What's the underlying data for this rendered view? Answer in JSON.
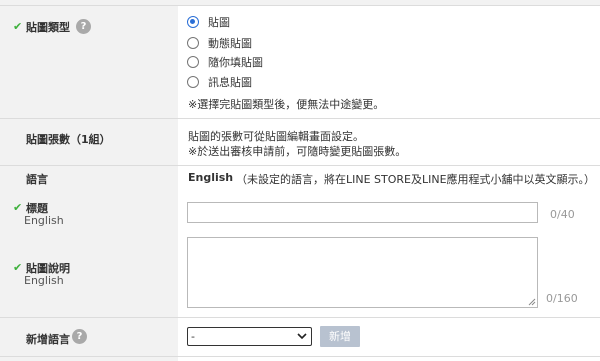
{
  "sticker_type": {
    "label": "貼圖類型",
    "help": "?",
    "check": "✔",
    "options": [
      "貼圖",
      "動態貼圖",
      "隨你填貼圖",
      "訊息貼圖"
    ],
    "selected_index": 0,
    "note": "※選擇完貼圖類型後，便無法中途變更。"
  },
  "sticker_count": {
    "label": "貼圖張數（1組）",
    "line1": "貼圖的張數可從貼圖編輯畫面設定。",
    "line2": "※於送出審核申請前，可隨時變更貼圖張數。"
  },
  "language": {
    "label": "語言",
    "value": "English",
    "note": "（未設定的語言，將在LINE STORE及LINE應用程式小舖中以英文顯示。）"
  },
  "title_field": {
    "check": "✔",
    "label": "標題",
    "sublabel": "English",
    "value": "",
    "counter": "0/40"
  },
  "description_field": {
    "check": "✔",
    "label": "貼圖說明",
    "sublabel": "English",
    "value": "",
    "counter": "0/160"
  },
  "add_language": {
    "label": "新增語言",
    "help": "?",
    "select_value": "-",
    "button": "新增"
  },
  "colors": {
    "check": "#3eb13c",
    "radio_selected": "#2b6fd6",
    "button_disabled": "#b8c2d0",
    "left_column_bg": "#f2f2f2"
  }
}
